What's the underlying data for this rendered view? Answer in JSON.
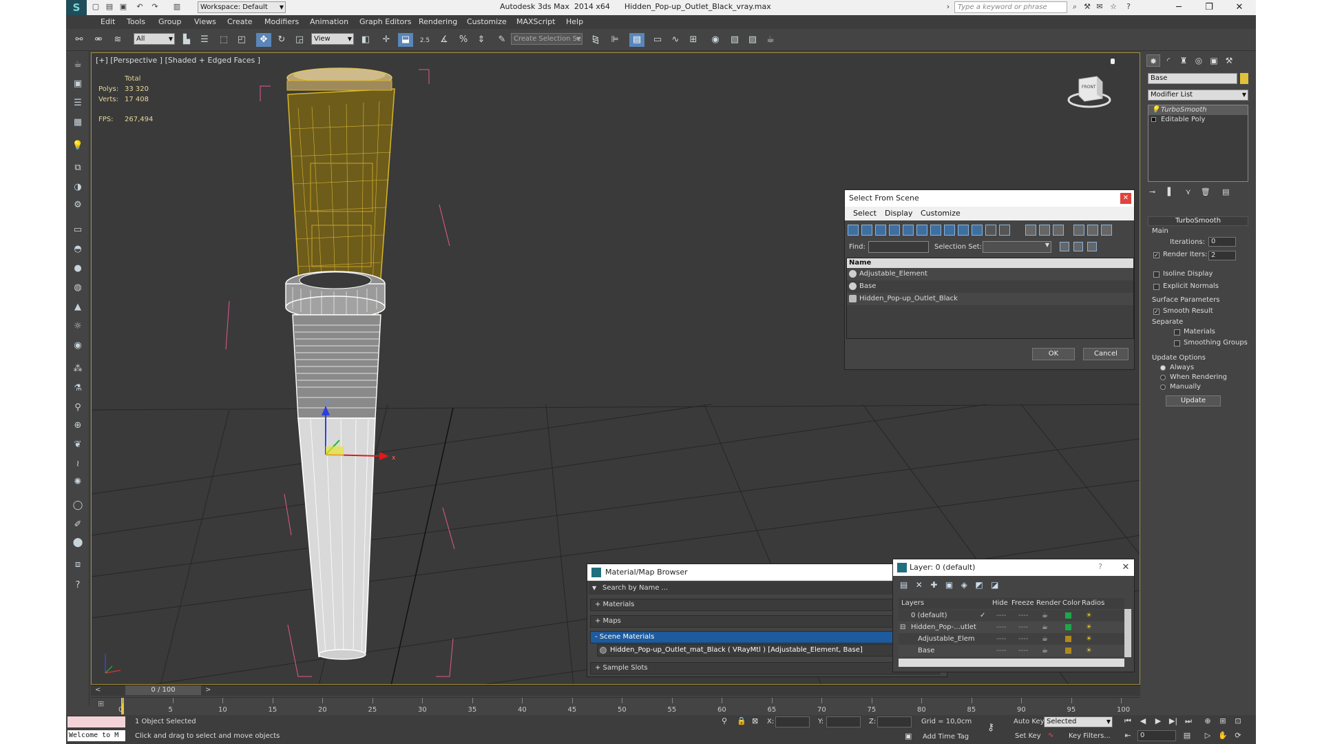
{
  "title": {
    "app_name": "Autodesk 3ds Max  2014 x64",
    "file_name": "Hidden_Pop-up_Outlet_Black_vray.max",
    "workspace": "Workspace: Default",
    "search_placeholder": "Type a keyword or phrase"
  },
  "menu": [
    "Edit",
    "Tools",
    "Group",
    "Views",
    "Create",
    "Modifiers",
    "Animation",
    "Graph Editors",
    "Rendering",
    "Customize",
    "MAXScript",
    "Help"
  ],
  "toolbar": {
    "selection_filter": "All",
    "ref_coord": "View",
    "snap_value": "2.5",
    "selection_set_placeholder": "Create Selection Se"
  },
  "viewport": {
    "label": "[+] [Perspective ] [Shaded + Edged Faces ]",
    "stats": {
      "total_label": "Total",
      "polys_label": "Polys:",
      "polys": "33 320",
      "verts_label": "Verts:",
      "verts": "17 408",
      "fps_label": "FPS:",
      "fps": "267,494"
    },
    "viewcube_label": "FRONT"
  },
  "select_from_scene": {
    "title": "Select From Scene",
    "tabs": [
      "Select",
      "Display",
      "Customize"
    ],
    "find_label": "Find:",
    "selection_set_label": "Selection Set:",
    "column": "Name",
    "rows": [
      "Adjustable_Element",
      "Base",
      "Hidden_Pop-up_Outlet_Black"
    ],
    "ok": "OK",
    "cancel": "Cancel"
  },
  "material_browser": {
    "title": "Material/Map Browser",
    "search": "Search by Name ...",
    "materials": "+ Materials",
    "maps": "+ Maps",
    "scene_materials": "- Scene Materials",
    "scene_item": "Hidden_Pop-up_Outlet_mat_Black  ( VRayMtl ) [Adjustable_Element, Base]",
    "sample_slots": "+ Sample Slots"
  },
  "layer_dialog": {
    "title": "Layer: 0 (default)",
    "help": "?",
    "columns": [
      "Layers",
      "Hide",
      "Freeze",
      "Render",
      "Color",
      "Radios"
    ],
    "rows": [
      {
        "name": "0 (default)",
        "color": "#1fa64a"
      },
      {
        "name": "Hidden_Pop-...utlet",
        "color": "#1fa64a"
      },
      {
        "name": "Adjustable_Elem",
        "color": "#b08a1e"
      },
      {
        "name": "Base",
        "color": "#b08a1e"
      }
    ],
    "dash": "----"
  },
  "command_panel": {
    "object_name": "Base",
    "object_color": "#e0c23a",
    "modifier_list": "Modifier List",
    "stack": [
      "TurboSmooth",
      "Editable Poly"
    ],
    "rollout_title": "TurboSmooth",
    "main_label": "Main",
    "iterations_label": "Iterations:",
    "iterations": "0",
    "render_iters_label": "Render Iters:",
    "render_iters": "2",
    "isoline": "Isoline Display",
    "explicit": "Explicit Normals",
    "surface_params": "Surface Parameters",
    "smooth_result": "Smooth Result",
    "separate": "Separate",
    "materials": "Materials",
    "smoothing_groups": "Smoothing Groups",
    "update_options": "Update Options",
    "always": "Always",
    "when_rendering": "When Rendering",
    "manually": "Manually",
    "update": "Update"
  },
  "timeline": {
    "frame": "0 / 100",
    "ticks": [
      "0",
      "5",
      "10",
      "15",
      "20",
      "25",
      "30",
      "35",
      "40",
      "45",
      "50",
      "55",
      "60",
      "65",
      "70",
      "75",
      "80",
      "85",
      "90",
      "95",
      "100"
    ]
  },
  "status": {
    "welcome": "Welcome to M",
    "selected": "1 Object Selected",
    "prompt": "Click and drag to select and move objects",
    "x_label": "X:",
    "y_label": "Y:",
    "z_label": "Z:",
    "grid": "Grid = 10,0cm",
    "add_time_tag": "Add Time Tag",
    "auto_key": "Auto Key",
    "set_key": "Set Key",
    "selected_dd": "Selected",
    "key_filters": "Key Filters...",
    "frame_field": "0"
  }
}
